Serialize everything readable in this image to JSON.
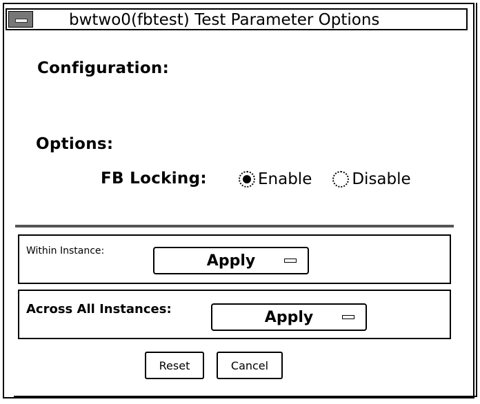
{
  "window": {
    "title": "bwtwo0(fbtest) Test Parameter Options"
  },
  "sections": {
    "configuration_label": "Configuration:",
    "options_label": "Options:"
  },
  "fb_locking": {
    "label": "FB Locking:",
    "options": [
      {
        "label": "Enable",
        "selected": true
      },
      {
        "label": "Disable",
        "selected": false
      }
    ]
  },
  "within_instance": {
    "label": "Within Instance:",
    "button_label": "Apply"
  },
  "across_instances": {
    "label": "Across All Instances:",
    "button_label": "Apply"
  },
  "footer": {
    "reset_label": "Reset",
    "cancel_label": "Cancel"
  }
}
